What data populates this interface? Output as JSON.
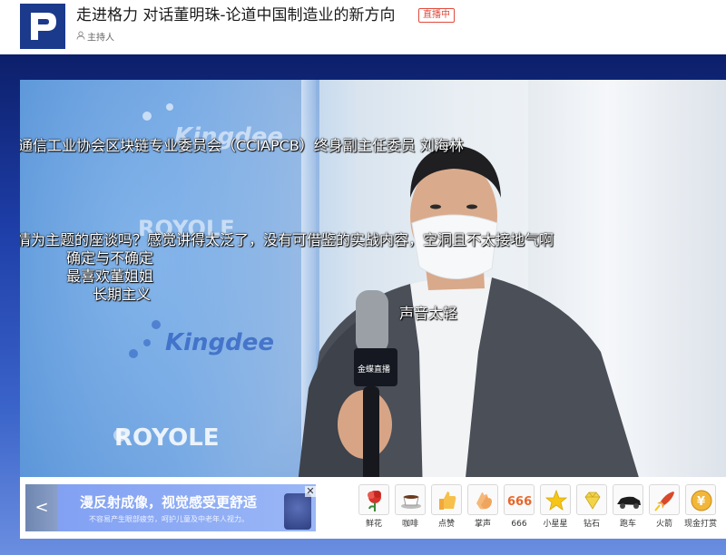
{
  "header": {
    "title": "走进格力 对话董明珠-论道中国制造业的新方向",
    "live_badge": "直播中",
    "host_label": "主持人"
  },
  "video": {
    "backdrop_brands": [
      "Kingdee",
      "ROYOLE",
      "Kingdee",
      "ROYOLE"
    ],
    "mic_brand": "金蝶直播"
  },
  "danmaku": [
    "通信工业协会区块链专业委员会（CCIAPCB）终身副主任委员 刘海林",
    "情为主题的座谈吗？感觉讲得太泛了，没有可借鉴的实战内容，空洞且不太接地气啊",
    "确定与不确定",
    "最喜欢董姐姐",
    "长期主义",
    "声音太轻"
  ],
  "ad": {
    "headline": "漫反射成像，视觉感受更舒适",
    "subtext": "不容易产生眼部疲劳，呵护儿童及中老年人视力。",
    "prev_label": "<",
    "close_label": "✕"
  },
  "gifts": [
    {
      "label": "鲜花",
      "icon": "flower-icon"
    },
    {
      "label": "咖啡",
      "icon": "coffee-icon"
    },
    {
      "label": "点赞",
      "icon": "thumbs-up-icon"
    },
    {
      "label": "掌声",
      "icon": "clap-icon"
    },
    {
      "label": "666",
      "icon": "six-six-six-icon"
    },
    {
      "label": "小星星",
      "icon": "star-icon"
    },
    {
      "label": "钻石",
      "icon": "diamond-icon"
    },
    {
      "label": "跑车",
      "icon": "sports-car-icon"
    },
    {
      "label": "火箭",
      "icon": "rocket-icon"
    },
    {
      "label": "现金打赏",
      "icon": "cash-tip-icon"
    }
  ],
  "gift_666_text": "666",
  "cash_symbol": "¥",
  "colors": {
    "header_bg": "#ffffff",
    "logo_bg": "#1b3a8c",
    "live_badge": "#e04a3c",
    "stage_top": "#0c1f6a",
    "stage_bottom": "#6a8ee0",
    "ad_bg": "#8aa8f4"
  }
}
